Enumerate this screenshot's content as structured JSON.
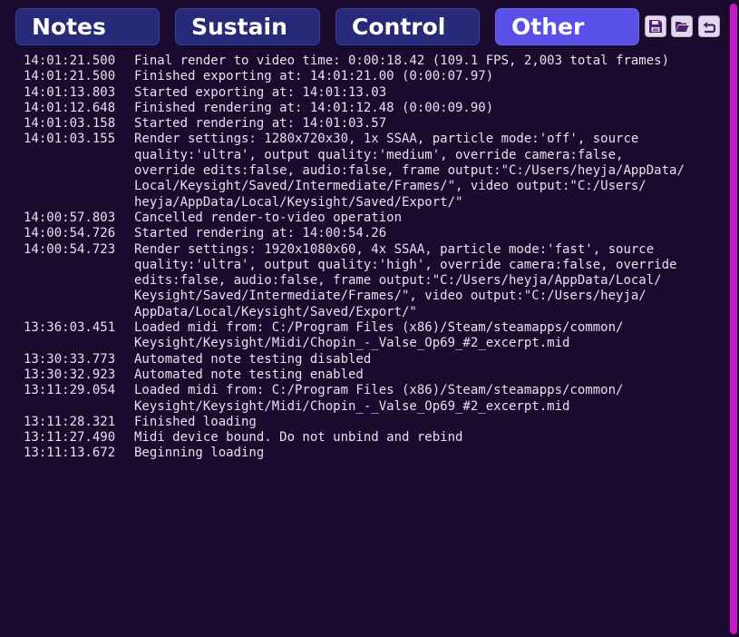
{
  "tabs": [
    {
      "label": "Notes",
      "active": false
    },
    {
      "label": "Sustain",
      "active": false
    },
    {
      "label": "Control",
      "active": false
    },
    {
      "label": "Other",
      "active": true
    }
  ],
  "toolbar": {
    "save_icon": "floppy-disk-icon",
    "open_icon": "folder-open-icon",
    "undo_icon": "undo-arrow-icon"
  },
  "colors": {
    "background": "#1a0a2e",
    "tab": "#262a78",
    "tab_active": "#5a4fe6",
    "scrollbar": "#c718c7"
  },
  "log": [
    {
      "time": "14:01:21.500",
      "message": "Final render to video time: 0:00:18.42 (109.1 FPS, 2,003 total frames)"
    },
    {
      "time": "14:01:21.500",
      "message": "Finished exporting at: 14:01:21.00 (0:00:07.97)"
    },
    {
      "time": "14:01:13.803",
      "message": "Started  exporting at: 14:01:13.03"
    },
    {
      "time": "14:01:12.648",
      "message": "Finished rendering at: 14:01:12.48 (0:00:09.90)"
    },
    {
      "time": "14:01:03.158",
      "message": "Started  rendering at: 14:01:03.57"
    },
    {
      "time": "14:01:03.155",
      "message": "Render settings: 1280x720x30, 1x SSAA, particle mode:'off', source\nquality:'ultra', output quality:'medium', override camera:false,\noverride edits:false, audio:false, frame output:\"C:/Users/heyja/AppData/\nLocal/Keysight/Saved/Intermediate/Frames/\", video output:\"C:/Users/\nheyja/AppData/Local/Keysight/Saved/Export/\""
    },
    {
      "time": "14:00:57.803",
      "message": "Cancelled render-to-video operation"
    },
    {
      "time": "14:00:54.726",
      "message": "Started  rendering at: 14:00:54.26"
    },
    {
      "time": "14:00:54.723",
      "message": "Render settings: 1920x1080x60, 4x SSAA, particle mode:'fast', source\nquality:'ultra', output quality:'high', override camera:false, override\nedits:false, audio:false, frame output:\"C:/Users/heyja/AppData/Local/\nKeysight/Saved/Intermediate/Frames/\", video output:\"C:/Users/heyja/\nAppData/Local/Keysight/Saved/Export/\""
    },
    {
      "time": "13:36:03.451",
      "message": "Loaded midi from: C:/Program Files (x86)/Steam/steamapps/common/\nKeysight/Keysight/Midi/Chopin_-_Valse_Op69_#2_excerpt.mid"
    },
    {
      "time": "13:30:33.773",
      "message": "Automated note testing disabled"
    },
    {
      "time": "13:30:32.923",
      "message": "Automated note testing enabled"
    },
    {
      "time": "13:11:29.054",
      "message": "Loaded midi from: C:/Program Files (x86)/Steam/steamapps/common/\nKeysight/Keysight/Midi/Chopin_-_Valse_Op69_#2_excerpt.mid"
    },
    {
      "time": "13:11:28.321",
      "message": "Finished loading"
    },
    {
      "time": "13:11:27.490",
      "message": "Midi device bound. Do not unbind and rebind"
    },
    {
      "time": "13:11:13.672",
      "message": "Beginning loading"
    }
  ]
}
